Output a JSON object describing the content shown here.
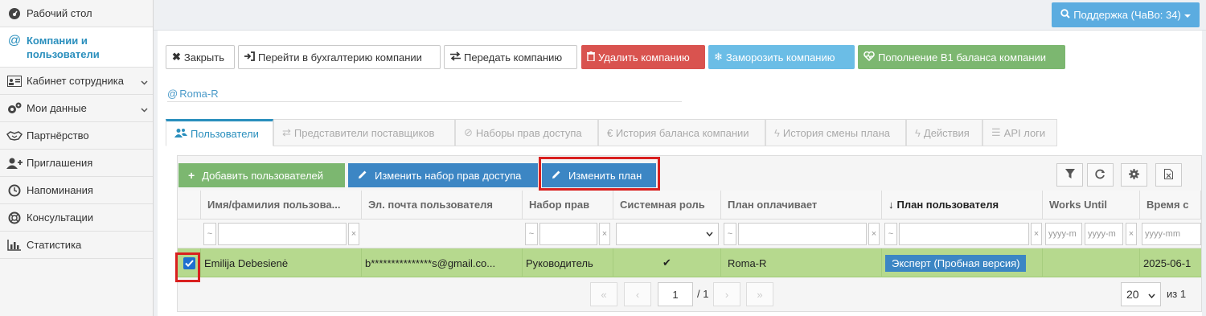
{
  "sidebar": {
    "items": [
      {
        "label": "Рабочий стол",
        "icon": "dashboard-icon"
      },
      {
        "label": "Компании и пользователи",
        "icon": "at-icon"
      },
      {
        "label": "Кабинет сотрудника",
        "icon": "id-card-icon"
      },
      {
        "label": "Мои данные",
        "icon": "cogs-icon"
      },
      {
        "label": "Партнёрство",
        "icon": "handshake-icon"
      },
      {
        "label": "Приглашения",
        "icon": "user-plus-icon"
      },
      {
        "label": "Напоминания",
        "icon": "clock-icon"
      },
      {
        "label": "Консультации",
        "icon": "lifebuoy-icon"
      },
      {
        "label": "Статистика",
        "icon": "bar-chart-icon"
      }
    ]
  },
  "topbar": {
    "support_label": "Поддержка (ЧаВо: 34)"
  },
  "actions": {
    "close": "Закрыть",
    "goto_accounting": "Перейти в бухгалтерию компании",
    "transfer": "Передать компанию",
    "delete": "Удалить компанию",
    "freeze": "Заморозить компанию",
    "topup": "Пополнение B1 баланса компании"
  },
  "company": {
    "name": "Roma-R"
  },
  "tabs": [
    {
      "label": "Пользователи",
      "active": true
    },
    {
      "label": "Представители поставщиков"
    },
    {
      "label": "Наборы прав доступа"
    },
    {
      "label": "€ История баланса компании"
    },
    {
      "label": "История смены плана"
    },
    {
      "label": "Действия"
    },
    {
      "label": "API логи"
    }
  ],
  "toolbar": {
    "add_users": "Добавить пользователей",
    "change_rights": "Изменить набор прав доступа",
    "change_plan": "Изменить план"
  },
  "table": {
    "headers": [
      "Имя/фамилия пользова...",
      "Эл. почта пользователя",
      "Набор прав",
      "Системная роль",
      "План оплачивает",
      "План пользователя",
      "Works Until",
      "Время с"
    ],
    "filter": {
      "tilde": "~",
      "clear": "×",
      "date_placeholder": "yyyy-mm",
      "date_placeholder_short": "yyyy-m"
    },
    "rows": [
      {
        "name": "Emilija Debesienė",
        "email": "b***************s@gmail.co...",
        "rights": "Руководитель",
        "system_role": "✔",
        "plan_payer": "Roma-R",
        "user_plan": "Эксперт (Пробная версия)",
        "works_until": "",
        "time": "2025-06-1",
        "selected": true
      }
    ]
  },
  "pager": {
    "first": "«",
    "prev": "‹",
    "page": "1",
    "total": "/ 1",
    "next": "›",
    "last": "»",
    "page_size": "20",
    "of_total": "из 1"
  },
  "colors": {
    "accent": "#2a8fbd",
    "selected_row": "#b6d98e",
    "highlight": "#d9201f"
  }
}
